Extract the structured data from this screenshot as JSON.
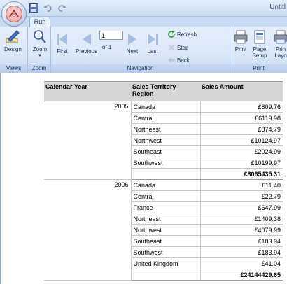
{
  "window": {
    "title": "Untitl",
    "quick_access": [
      "save-icon",
      "undo-icon",
      "redo-icon"
    ]
  },
  "tabs": [
    {
      "label": "Run",
      "active": true
    }
  ],
  "ribbon": {
    "groups": {
      "views": "Views",
      "zoom": "Zoom",
      "navigation": "Navigation",
      "print": "Print"
    },
    "design_label": "Design",
    "zoom_label": "Zoom",
    "first_label": "First",
    "previous_label": "Previous",
    "page_value": "1",
    "of_text": "of  1",
    "next_label": "Next",
    "last_label": "Last",
    "refresh_label": "Refresh",
    "stop_label": "Stop",
    "back_label": "Back",
    "print_label": "Print",
    "page_setup_label_1": "Page",
    "page_setup_label_2": "Setup",
    "print_layout_label_1": "Prin",
    "print_layout_label_2": "Layo"
  },
  "report": {
    "columns": [
      "Calendar Year",
      "Sales Territory Region",
      "Sales Amount"
    ],
    "groups": [
      {
        "year": "2005",
        "rows": [
          {
            "region": "Canada",
            "amount": "£809.76"
          },
          {
            "region": "Central",
            "amount": "£6119.98"
          },
          {
            "region": "Northeast",
            "amount": "£874.79"
          },
          {
            "region": "Northwest",
            "amount": "£10124.97"
          },
          {
            "region": "Southeast",
            "amount": "£2024.99"
          },
          {
            "region": "Southwest",
            "amount": "£10199.97"
          }
        ],
        "total": "£8065435.31"
      },
      {
        "year": "2006",
        "rows": [
          {
            "region": "Canada",
            "amount": "£11.40"
          },
          {
            "region": "Central",
            "amount": "£22.79"
          },
          {
            "region": "France",
            "amount": "£647.99"
          },
          {
            "region": "Northeast",
            "amount": "£1409.38"
          },
          {
            "region": "Northwest",
            "amount": "£4079.99"
          },
          {
            "region": "Southeast",
            "amount": "£183.94"
          },
          {
            "region": "Southwest",
            "amount": "£183.94"
          },
          {
            "region": "United Kingdom",
            "amount": "£41.04"
          }
        ],
        "total": "£24144429.65"
      }
    ]
  }
}
